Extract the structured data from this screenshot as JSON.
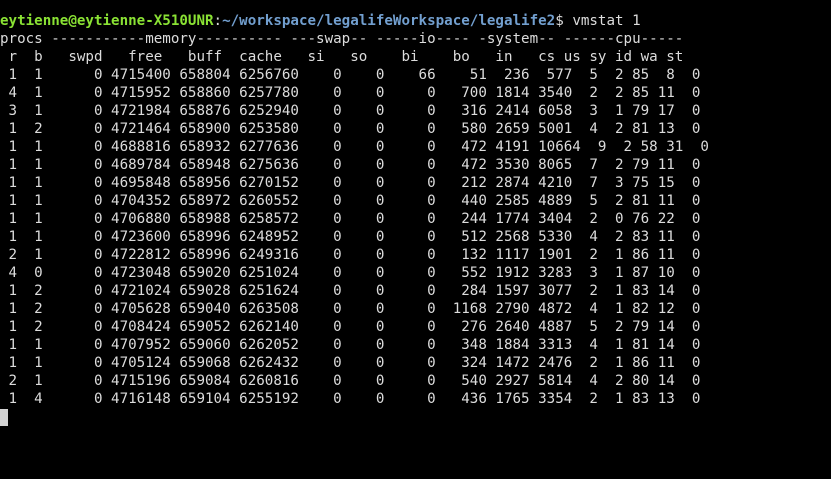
{
  "prompt": {
    "user_host": "eytienne@eytienne-X510UNR",
    "separator": ":",
    "path": "~/workspace/legalifeWorkspace/legalife2",
    "symbol": "$ ",
    "command": "vmstat 1"
  },
  "header": {
    "groups": "procs -----------memory---------- ---swap-- -----io---- -system-- ------cpu-----",
    "columns": " r  b   swpd   free   buff  cache   si   so    bi    bo   in   cs us sy id wa st"
  },
  "rows": [
    " 1  1      0 4715400 658804 6256760    0    0    66    51  236  577  5  2 85  8  0",
    " 4  1      0 4715952 658860 6257780    0    0     0   700 1814 3540  2  2 85 11  0",
    " 3  1      0 4721984 658876 6252940    0    0     0   316 2414 6058  3  1 79 17  0",
    " 1  2      0 4721464 658900 6253580    0    0     0   580 2659 5001  4  2 81 13  0",
    " 1  1      0 4688816 658932 6277636    0    0     0   472 4191 10664  9  2 58 31  0",
    " 1  1      0 4689784 658948 6275636    0    0     0   472 3530 8065  7  2 79 11  0",
    " 1  1      0 4695848 658956 6270152    0    0     0   212 2874 4210  7  3 75 15  0",
    " 1  1      0 4704352 658972 6260552    0    0     0   440 2585 4889  5  2 81 11  0",
    " 1  1      0 4706880 658988 6258572    0    0     0   244 1774 3404  2  0 76 22  0",
    " 1  1      0 4723600 658996 6248952    0    0     0   512 2568 5330  4  2 83 11  0",
    " 2  1      0 4722812 658996 6249316    0    0     0   132 1117 1901  2  1 86 11  0",
    " 4  0      0 4723048 659020 6251024    0    0     0   552 1912 3283  3  1 87 10  0",
    " 1  2      0 4721024 659028 6251624    0    0     0   284 1597 3077  2  1 83 14  0",
    " 1  2      0 4705628 659040 6263508    0    0     0  1168 2790 4872  4  1 82 12  0",
    " 1  2      0 4708424 659052 6262140    0    0     0   276 2640 4887  5  2 79 14  0",
    " 1  1      0 4707952 659060 6262052    0    0     0   348 1884 3313  4  1 81 14  0",
    " 1  1      0 4705124 659068 6262432    0    0     0   324 1472 2476  2  1 86 11  0",
    " 2  1      0 4715196 659084 6260816    0    0     0   540 2927 5814  4  2 80 14  0",
    " 1  4      0 4716148 659104 6255192    0    0     0   436 1765 3354  2  1 83 13  0"
  ],
  "colors": {
    "background": "#000000",
    "text": "#dcdcdc",
    "user_host": "#8ae234",
    "path": "#729fcf"
  }
}
